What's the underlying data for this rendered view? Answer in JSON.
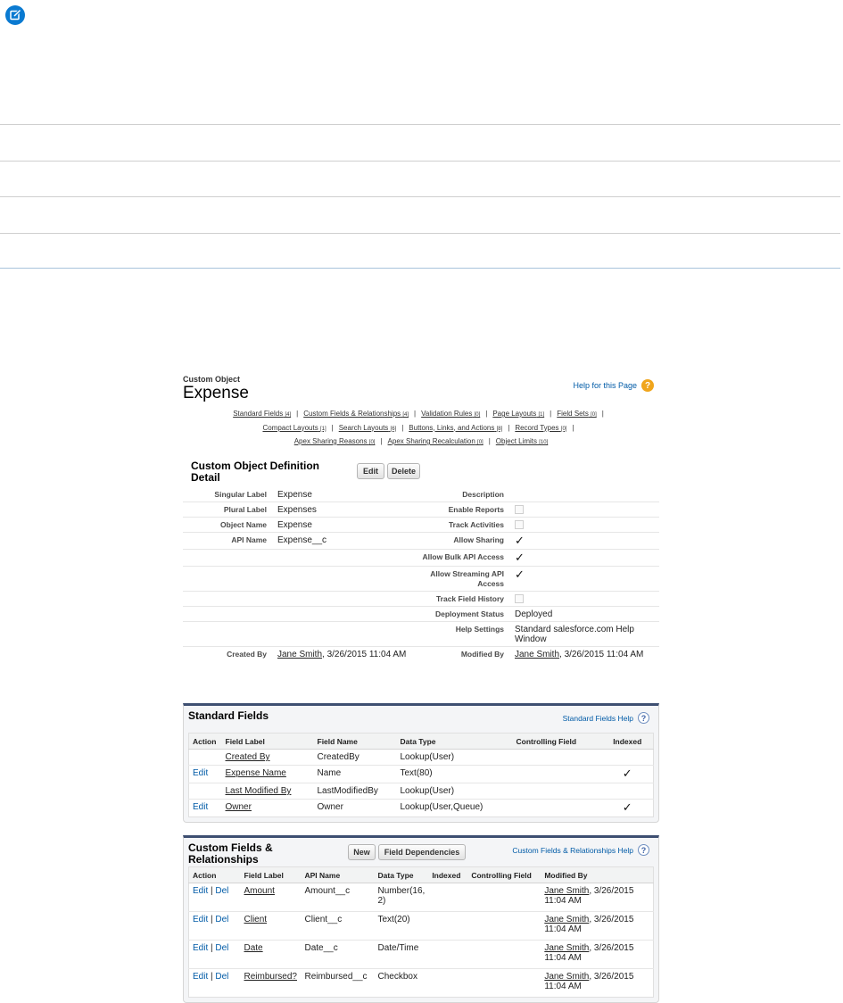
{
  "header": {
    "object_type": "Custom Object",
    "object_name": "Expense",
    "help_link": "Help for this Page"
  },
  "nav_links": [
    {
      "label": "Standard Fields",
      "count": "[4]"
    },
    {
      "label": "Custom Fields & Relationships",
      "count": "[4]"
    },
    {
      "label": "Validation Rules",
      "count": "[0]"
    },
    {
      "label": "Page Layouts",
      "count": "[1]"
    },
    {
      "label": "Field Sets",
      "count": "[0]"
    },
    {
      "label": "Compact Layouts",
      "count": "[1]"
    },
    {
      "label": "Search Layouts",
      "count": "[6]"
    },
    {
      "label": "Buttons, Links, and Actions",
      "count": "[8]"
    },
    {
      "label": "Record Types",
      "count": "[0]"
    },
    {
      "label": "Apex Sharing Reasons",
      "count": "[0]"
    },
    {
      "label": "Apex Sharing Recalculation",
      "count": "[0]"
    },
    {
      "label": "Object Limits",
      "count": "[10]"
    }
  ],
  "detail": {
    "title": "Custom Object Definition Detail",
    "edit_label": "Edit",
    "delete_label": "Delete",
    "singular_label": "Singular Label",
    "singular_value": "Expense",
    "plural_label": "Plural Label",
    "plural_value": "Expenses",
    "object_name_label": "Object Name",
    "object_name_value": "Expense",
    "api_name_label": "API Name",
    "api_name_value": "Expense__c",
    "description_label": "Description",
    "enable_reports_label": "Enable Reports",
    "track_activities_label": "Track Activities",
    "allow_sharing_label": "Allow Sharing",
    "allow_bulk_label": "Allow Bulk API Access",
    "allow_streaming_label": "Allow Streaming API Access",
    "track_history_label": "Track Field History",
    "deployment_label": "Deployment Status",
    "deployment_value": "Deployed",
    "help_settings_label": "Help Settings",
    "help_settings_value": "Standard salesforce.com Help Window",
    "created_by_label": "Created By",
    "created_by_user": "Jane Smith",
    "created_by_date": ", 3/26/2015 11:04 AM",
    "modified_by_label": "Modified By",
    "modified_by_user": "Jane Smith",
    "modified_by_date": ", 3/26/2015 11:04 AM",
    "checkmark": "✓"
  },
  "standard_fields": {
    "title": "Standard Fields",
    "help": "Standard Fields Help",
    "columns": [
      "Action",
      "Field Label",
      "Field Name",
      "Data Type",
      "Controlling Field",
      "Indexed"
    ],
    "rows": [
      {
        "action": "",
        "label": "Created By",
        "name": "CreatedBy",
        "type": "Lookup(User)",
        "controlling": "",
        "indexed": ""
      },
      {
        "action": "Edit",
        "label": "Expense Name",
        "name": "Name",
        "type": "Text(80)",
        "controlling": "",
        "indexed": "✓"
      },
      {
        "action": "",
        "label": "Last Modified By",
        "name": "LastModifiedBy",
        "type": "Lookup(User)",
        "controlling": "",
        "indexed": ""
      },
      {
        "action": "Edit",
        "label": "Owner",
        "name": "Owner",
        "type": "Lookup(User,Queue)",
        "controlling": "",
        "indexed": "✓"
      }
    ]
  },
  "custom_fields": {
    "title": "Custom Fields & Relationships",
    "new_label": "New",
    "deps_label": "Field Dependencies",
    "help": "Custom Fields & Relationships Help",
    "columns": [
      "Action",
      "Field Label",
      "API Name",
      "Data Type",
      "Indexed",
      "Controlling Field",
      "Modified By"
    ],
    "rows": [
      {
        "edit": "Edit",
        "sep": " | ",
        "del": "Del",
        "label": "Amount",
        "api": "Amount__c",
        "type": "Number(16, 2)",
        "indexed": "",
        "controlling": "",
        "user": "Jane Smith",
        "date": ", 3/26/2015 11:04 AM"
      },
      {
        "edit": "Edit",
        "sep": " | ",
        "del": "Del",
        "label": "Client",
        "api": "Client__c",
        "type": "Text(20)",
        "indexed": "",
        "controlling": "",
        "user": "Jane Smith",
        "date": ", 3/26/2015 11:04 AM"
      },
      {
        "edit": "Edit",
        "sep": " | ",
        "del": "Del",
        "label": "Date",
        "api": "Date__c",
        "type": "Date/Time",
        "indexed": "",
        "controlling": "",
        "user": "Jane Smith",
        "date": ", 3/26/2015 11:04 AM"
      },
      {
        "edit": "Edit",
        "sep": " | ",
        "del": "Del",
        "label": "Reimbursed?",
        "api": "Reimbursed__c",
        "type": "Checkbox",
        "indexed": "",
        "controlling": "",
        "user": "Jane Smith",
        "date": ", 3/26/2015 11:04 AM"
      }
    ]
  },
  "colors": {
    "note_icon": "#0a7ad1",
    "link": "#015ba7",
    "panel_border": "#3e4f71",
    "help_icon": "#f0a51c"
  }
}
